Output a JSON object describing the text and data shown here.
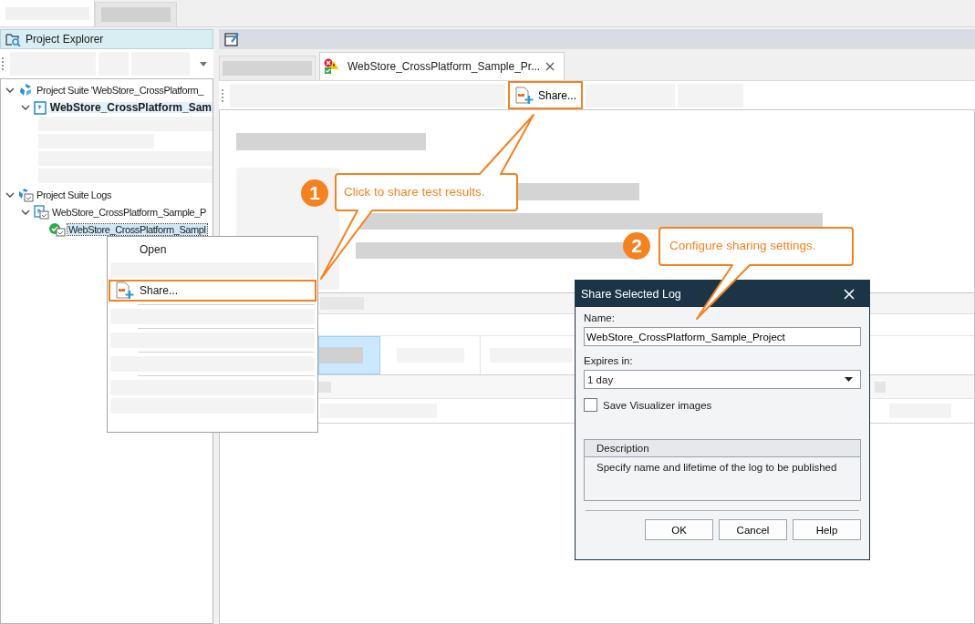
{
  "project_explorer": {
    "title": "Project Explorer"
  },
  "tree": [
    {
      "label": "Project Suite 'WebStore_CrossPlatform_",
      "kind": "suite",
      "selected": false,
      "expanded": true,
      "children": [
        {
          "label": "WebStore_CrossPlatform_Sam",
          "kind": "project",
          "selected": true,
          "expanded": true
        }
      ]
    },
    {
      "label": "Project Suite Logs",
      "kind": "logs",
      "selected": false,
      "expanded": true,
      "children": [
        {
          "label": "WebStore_CrossPlatform_Sample_P",
          "kind": "project_log",
          "selected": false,
          "expanded": true,
          "children": [
            {
              "label": "WebStore_CrossPlatform_Sampl",
              "kind": "test_log",
              "selected": true
            }
          ]
        }
      ]
    }
  ],
  "editor_tab": {
    "title": "WebStore_CrossPlatform_Sample_Pr...",
    "selected": true
  },
  "report_tabs": [
    {
      "selected": true
    },
    {
      "selected": false
    },
    {
      "selected": false
    }
  ],
  "toolbar": {
    "share_button": {
      "label": "Share...",
      "highlighted": true
    }
  },
  "context_menu": {
    "items": [
      {
        "label": "Open",
        "kind": "plain",
        "highlighted": false
      },
      {
        "label": "Share...",
        "kind": "share",
        "highlighted": true
      }
    ]
  },
  "dialog": {
    "title": "Share Selected Log",
    "name_label": "Name:",
    "name_value": "WebStore_CrossPlatform_Sample_Project",
    "expires_label": "Expires in:",
    "expires_value": "1 day",
    "checkbox": {
      "label": "Save Visualizer images",
      "checked": false
    },
    "description": {
      "title": "Description",
      "text": "Specify name and lifetime of the log to be published"
    },
    "buttons": [
      "OK",
      "Cancel",
      "Help"
    ]
  },
  "callouts": [
    {
      "number": "1",
      "text": "Click to share test results."
    },
    {
      "number": "2",
      "text": "Configure sharing settings."
    }
  ]
}
